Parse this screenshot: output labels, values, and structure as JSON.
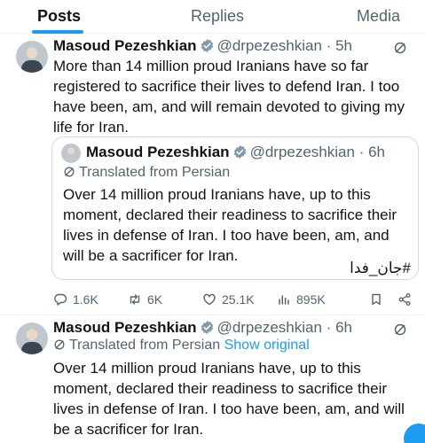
{
  "tabs": [
    {
      "label": "Posts",
      "active": true
    },
    {
      "label": "Replies",
      "active": false
    },
    {
      "label": "Media",
      "active": false
    }
  ],
  "tweet1": {
    "name": "Masoud Pezeshkian",
    "handle": "@drpezeshkian",
    "separator": "·",
    "time": "5h",
    "text": "More than 14 million proud Iranians have so far registered to sacrifice their lives to defend Iran. I too have been, am, and will remain devoted to giving my life for Iran.",
    "quote": {
      "name": "Masoud Pezeshkian",
      "handle": "@drpezeshkian",
      "separator": "·",
      "time": "6h",
      "translated_label": "Translated from Persian",
      "text": "Over 14 million proud Iranians have, up to this moment, declared their readiness to sacrifice their lives in defense of Iran. I too have been, am, and will be a sacrificer for Iran.",
      "hashtag": "#جان_فدا"
    },
    "stats": {
      "replies": "1.6K",
      "reposts": "6K",
      "likes": "25.1K",
      "views": "895K"
    }
  },
  "tweet2": {
    "name": "Masoud Pezeshkian",
    "handle": "@drpezeshkian",
    "separator": "·",
    "time": "6h",
    "translated_label": "Translated from Persian",
    "show_original": "Show original",
    "text": "Over 14 million proud Iranians have, up to this moment, declared their readiness to sacrifice their lives in defense of Iran. I too have been, am, and will be a sacrificer for Iran."
  },
  "colors": {
    "accent": "#1d9bf0",
    "verified": "#829aab",
    "muted": "#536471",
    "text": "#0f1419",
    "border": "#cfd9de"
  },
  "icons": [
    "verified-badge-icon",
    "grok-icon",
    "translate-icon",
    "reply-icon",
    "repost-icon",
    "like-icon",
    "views-icon",
    "bookmark-icon",
    "share-icon"
  ]
}
